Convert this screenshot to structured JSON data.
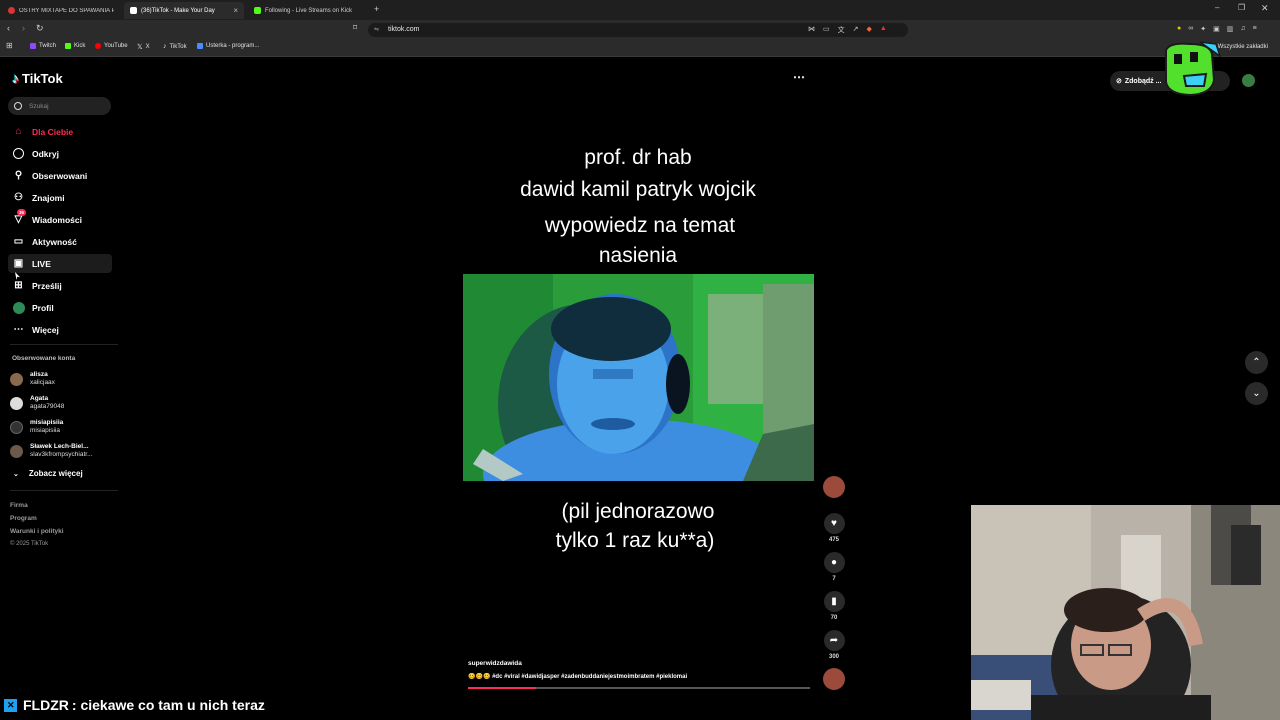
{
  "browser": {
    "tabs": [
      {
        "title": "OSTRY MIXTAPE DO SPAWANIA POD...",
        "active": false,
        "color": "#d33"
      },
      {
        "title": "(36)TikTok - Make Your Day",
        "active": true,
        "color": "#111"
      },
      {
        "title": "Following - Live Streams on Kick",
        "active": false,
        "color": "#53fc18"
      }
    ],
    "url": "tiktok.com",
    "bookmarks": [
      "Twitch",
      "Kick",
      "YouTube",
      "X",
      "TikTok",
      "Usterka - program..."
    ],
    "bookmarks_right": "Wszystkie zakładki"
  },
  "sidebar": {
    "logo": "TikTok",
    "search_placeholder": "Szukaj",
    "nav": [
      {
        "label": "Dla Ciebie",
        "icon": "home-icon",
        "active": true
      },
      {
        "label": "Odkryj",
        "icon": "compass-icon"
      },
      {
        "label": "Obserwowani",
        "icon": "following-icon"
      },
      {
        "label": "Znajomi",
        "icon": "friends-icon"
      },
      {
        "label": "Wiadomości",
        "icon": "inbox-icon",
        "badge": "36"
      },
      {
        "label": "Aktywność",
        "icon": "activity-icon"
      },
      {
        "label": "LIVE",
        "icon": "live-icon"
      },
      {
        "label": "Prześlij",
        "icon": "upload-icon"
      },
      {
        "label": "Profil",
        "icon": "avatar-icon"
      },
      {
        "label": "Więcej",
        "icon": "more-icon"
      }
    ],
    "followed_title": "Obserwowane konta",
    "accounts": [
      {
        "name": "alisza",
        "handle": "xalicjaax"
      },
      {
        "name": "Agata",
        "handle": "agata79048"
      },
      {
        "name": "misiapisiia",
        "handle": "misiapisiia"
      },
      {
        "name": "Sławek Lech-Biel...",
        "handle": "slav3kfrompsychiatr..."
      }
    ],
    "see_more": "Zobacz więcej",
    "footer": [
      "Firma",
      "Program",
      "Warunki i polityki",
      "© 2025 TikTok"
    ]
  },
  "video": {
    "caption_top": [
      "prof. dr hab",
      "dawid kamil patryk wojcik"
    ],
    "caption_mid": [
      "wypowiedz na temat",
      "nasienia"
    ],
    "caption_bottom": [
      "(pil jednorazowo",
      "tylko 1 raz ku**a)"
    ],
    "author": "superwidzdawida",
    "description": "🥴🥴🥴 #dc #viral #dawidjasper #zadenbuddaniejestmoimbratem #pieklomai",
    "counts": {
      "likes": "475",
      "comments": "7",
      "saves": "70",
      "shares": "300"
    },
    "progress": 0.2
  },
  "topright": {
    "get_coins": "Zdobądź ..."
  },
  "chat": {
    "user": "FLDZR",
    "message": ": ciekawe co tam u nich teraz"
  },
  "colors": {
    "accent": "#fe2c55",
    "chat_icon": "#1da1f2"
  }
}
